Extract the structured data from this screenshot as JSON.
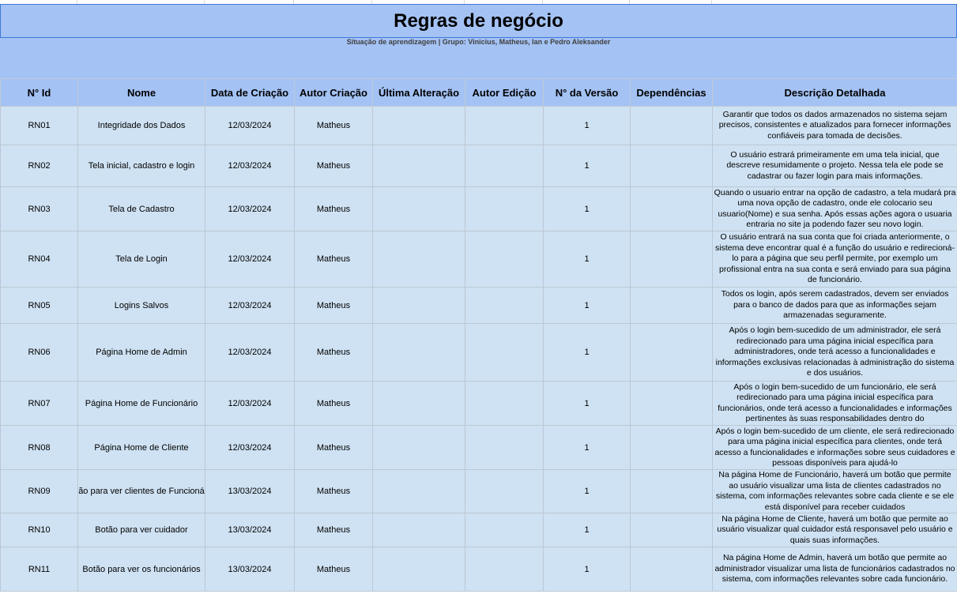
{
  "sheet": {
    "title": "Regras de negócio",
    "subtitle": "Situação de aprendizagem | Grupo: Vinicius, Matheus, Ian e Pedro Aleksander"
  },
  "columns": [
    "N° Id",
    "Nome",
    "Data de Criação",
    "Autor Criação",
    "Última Alteração",
    "Autor Edição",
    "N° da Versão",
    "Dependências",
    "Descrição Detalhada"
  ],
  "rows": [
    {
      "id": "RN01",
      "nome": "Integridade dos Dados",
      "data": "12/03/2024",
      "autor": "Matheus",
      "ultima": "",
      "editor": "",
      "versao": "1",
      "dep": "",
      "desc": "Garantir que todos os dados armazenados no sistema sejam precisos, consistentes e atualizados para fornecer informações confiáveis para tomada de decisões."
    },
    {
      "id": "RN02",
      "nome": "Tela inicial, cadastro e login",
      "data": "12/03/2024",
      "autor": "Matheus",
      "ultima": "",
      "editor": "",
      "versao": "1",
      "dep": "",
      "desc": "O usuário estrará primeiramente em uma tela inicial, que descreve resumidamente o projeto. Nessa tela ele pode se cadastrar ou fazer login para mais informações."
    },
    {
      "id": "RN03",
      "nome": "Tela de Cadastro",
      "data": "12/03/2024",
      "autor": "Matheus",
      "ultima": "",
      "editor": "",
      "versao": "1",
      "dep": "",
      "desc": "Quando o usuario entrar na opção de cadastro, a tela mudará pra uma nova opção de cadastro, onde ele colocario seu usuario(Nome) e sua senha. Após essas ações agora o usuaria entraria no site ja podendo fazer seu novo login."
    },
    {
      "id": "RN04",
      "nome": "Tela de Login",
      "data": "12/03/2024",
      "autor": "Matheus",
      "ultima": "",
      "editor": "",
      "versao": "1",
      "dep": "",
      "desc": "O usuário entrará na sua conta que foi criada anteriormente, o sistema deve encontrar qual é a função do usuário e redirecioná-lo para a página que seu perfil permite, por exemplo um profissional entra na sua conta e será enviado para sua página de funcionário."
    },
    {
      "id": "RN05",
      "nome": "Logins Salvos",
      "data": "12/03/2024",
      "autor": "Matheus",
      "ultima": "",
      "editor": "",
      "versao": "1",
      "dep": "",
      "desc": "Todos os login, após serem cadastrados, devem ser enviados para o banco de dados para que as informações sejam armazenadas seguramente."
    },
    {
      "id": "RN06",
      "nome": "Página Home de Admin",
      "data": "12/03/2024",
      "autor": "Matheus",
      "ultima": "",
      "editor": "",
      "versao": "1",
      "dep": "",
      "desc": "Após o login bem-sucedido de um administrador, ele será redirecionado para uma página inicial específica para administradores, onde terá acesso a funcionalidades e informações exclusivas relacionadas à administração do sistema e dos usuários."
    },
    {
      "id": "RN07",
      "nome": "Página Home de Funcionário",
      "data": "12/03/2024",
      "autor": "Matheus",
      "ultima": "",
      "editor": "",
      "versao": "1",
      "dep": "",
      "desc": "Após o login bem-sucedido de um funcionário, ele será redirecionado para uma página inicial específica para funcionários, onde terá acesso a funcionalidades e informações pertinentes às suas responsabilidades dentro do"
    },
    {
      "id": "RN08",
      "nome": "Página Home de Cliente",
      "data": "12/03/2024",
      "autor": "Matheus",
      "ultima": "",
      "editor": "",
      "versao": "1",
      "dep": "",
      "desc": "Após o login bem-sucedido de um cliente, ele será redirecionado para uma página inicial específica para clientes, onde terá acesso a funcionalidades e informações sobre seus cuidadores e pessoas disponíveis para ajudá-lo"
    },
    {
      "id": "RN09",
      "nome": "ão para ver clientes de Funcioná",
      "data": "13/03/2024",
      "autor": "Matheus",
      "ultima": "",
      "editor": "",
      "versao": "1",
      "dep": "",
      "desc": "Na página Home de Funcionário, haverá um botão que permite ao usuário visualizar uma lista de clientes cadastrados no sistema, com informações relevantes sobre cada cliente e se ele está disponível para receber cuidados"
    },
    {
      "id": "RN10",
      "nome": "Botão para ver cuidador",
      "data": "13/03/2024",
      "autor": "Matheus",
      "ultima": "",
      "editor": "",
      "versao": "1",
      "dep": "",
      "desc": "Na página Home de Cliente, haverá um botão que permite ao usuário visualizar qual cuidador está responsavel pelo usuário e quais suas informações."
    },
    {
      "id": "RN11",
      "nome": "Botão para ver os funcionários",
      "data": "13/03/2024",
      "autor": "Matheus",
      "ultima": "",
      "editor": "",
      "versao": "1",
      "dep": "",
      "desc": "Na página Home de Admin, haverá um botão que permite ao administrador visualizar uma lista de funcionários cadastrados no sistema, com informações relevantes sobre cada funcionário."
    }
  ]
}
